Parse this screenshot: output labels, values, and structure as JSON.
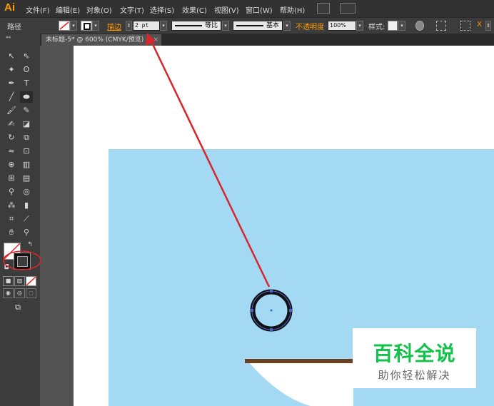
{
  "app": {
    "logo": "Ai"
  },
  "menu": [
    "文件(F)",
    "编辑(E)",
    "对象(O)",
    "文字(T)",
    "选择(S)",
    "效果(C)",
    "视图(V)",
    "窗口(W)",
    "帮助(H)"
  ],
  "control_bar": {
    "object_type": "路径",
    "stroke_label": "描边",
    "stroke_weight": "2 pt",
    "stroke_profile_1": "等比",
    "stroke_profile_2": "基本",
    "opacity_label": "不透明度",
    "opacity_value": "100%",
    "style_label": "样式:"
  },
  "document": {
    "tab_title": "未标题-5* @ 600% (CMYK/预览)"
  },
  "watermark": {
    "title": "百科全说",
    "subtitle": "助你轻松解决"
  },
  "colors": {
    "accent_orange": "#ff9a00",
    "annotation_red": "#d9262c",
    "sky": "#a3d9f3",
    "brown": "#6b4122",
    "watermark_green": "#13c24a"
  }
}
